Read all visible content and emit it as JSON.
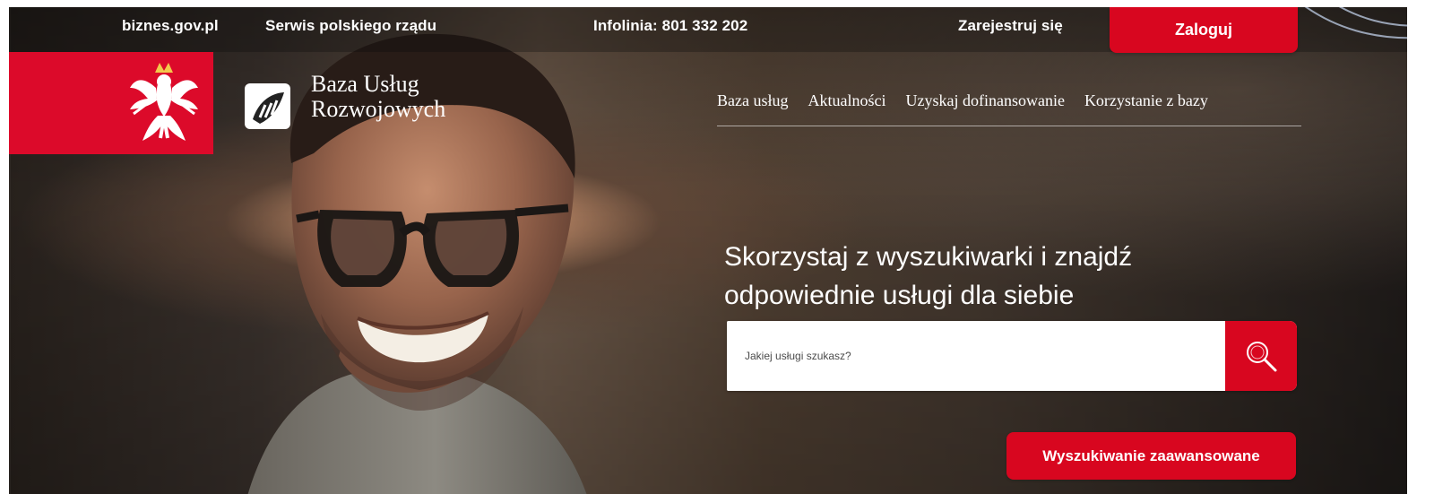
{
  "topbar": {
    "biznes": "biznes.gov.pl",
    "serwis": "Serwis polskiego rządu",
    "infolinia": "Infolinia: 801 332 202",
    "register": "Zarejestruj się",
    "login": "Zaloguj"
  },
  "brand": {
    "line1": "Baza Usług",
    "line2": "Rozwojowych"
  },
  "nav": [
    "Baza usług",
    "Aktualności",
    "Uzyskaj dofinansowanie",
    "Korzystanie z bazy"
  ],
  "hero": {
    "line1": "Skorzystaj z wyszukiwarki i znajdź",
    "line2": "odpowiednie usługi dla siebie"
  },
  "search": {
    "placeholder": "Jakiej usługi szukasz?",
    "icon": "search-icon"
  },
  "actions": {
    "advanced_search": "Wyszukiwanie zaawansowane"
  },
  "colors": {
    "accent_red": "#d8061f",
    "emblem_red": "#dc0a2a",
    "text_white": "#ffffff"
  }
}
